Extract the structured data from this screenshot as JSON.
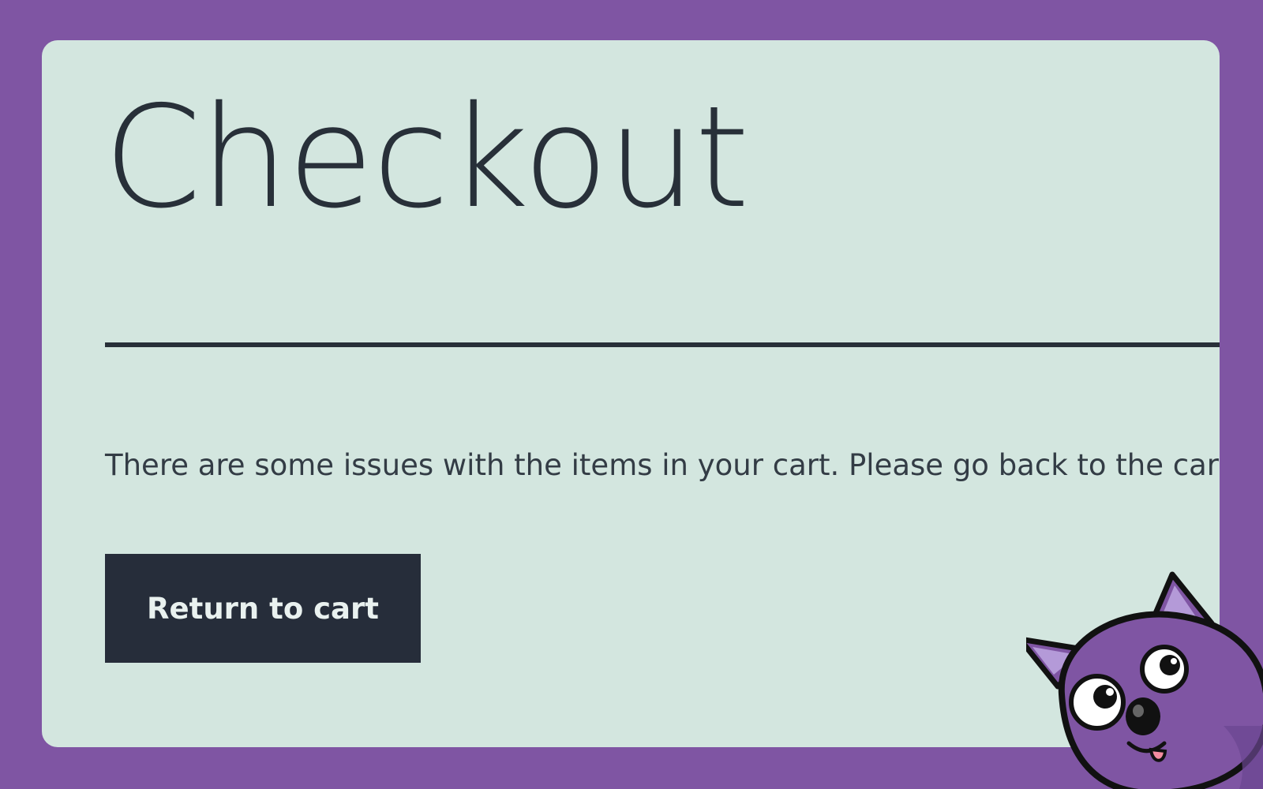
{
  "page": {
    "title": "Checkout",
    "message": "There are some issues with the items in your cart. Please go back to the cart",
    "return_button_label": "Return to cart"
  },
  "colors": {
    "background": "#7f55a3",
    "card": "#d3e6df",
    "text": "#283039",
    "button": "#262d3a",
    "button_text": "#e9f1ef"
  },
  "icons": {
    "mascot": "purple-fox-mascot-icon"
  }
}
